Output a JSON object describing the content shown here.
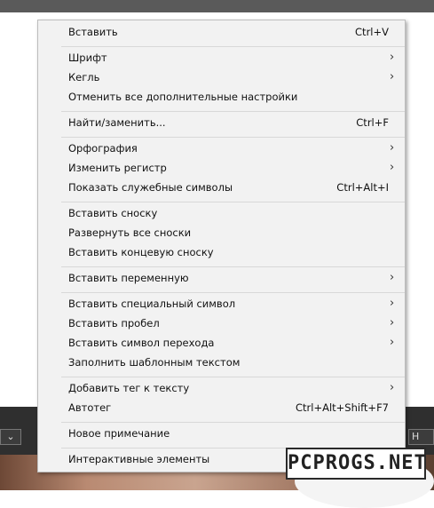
{
  "menu": {
    "items": [
      {
        "label": "Вставить",
        "shortcut": "Ctrl+V",
        "submenu": false
      },
      {
        "label": "Шрифт",
        "shortcut": "",
        "submenu": true
      },
      {
        "label": "Кегль",
        "shortcut": "",
        "submenu": true
      },
      {
        "label": "Отменить все дополнительные настройки",
        "shortcut": "",
        "submenu": false
      },
      {
        "label": "Найти/заменить...",
        "shortcut": "Ctrl+F",
        "submenu": false
      },
      {
        "label": "Орфография",
        "shortcut": "",
        "submenu": true
      },
      {
        "label": "Изменить регистр",
        "shortcut": "",
        "submenu": true
      },
      {
        "label": "Показать служебные символы",
        "shortcut": "Ctrl+Alt+I",
        "submenu": false
      },
      {
        "label": "Вставить сноску",
        "shortcut": "",
        "submenu": false
      },
      {
        "label": "Развернуть все сноски",
        "shortcut": "",
        "submenu": false
      },
      {
        "label": "Вставить концевую сноску",
        "shortcut": "",
        "submenu": false
      },
      {
        "label": "Вставить переменную",
        "shortcut": "",
        "submenu": true
      },
      {
        "label": "Вставить специальный символ",
        "shortcut": "",
        "submenu": true
      },
      {
        "label": "Вставить пробел",
        "shortcut": "",
        "submenu": true
      },
      {
        "label": "Вставить символ перехода",
        "shortcut": "",
        "submenu": true
      },
      {
        "label": "Заполнить шаблонным текстом",
        "shortcut": "",
        "submenu": false
      },
      {
        "label": "Добавить тег к тексту",
        "shortcut": "",
        "submenu": true
      },
      {
        "label": "Автотег",
        "shortcut": "Ctrl+Alt+Shift+F7",
        "submenu": false
      },
      {
        "label": "Новое примечание",
        "shortcut": "",
        "submenu": false
      },
      {
        "label": "Интерактивные элементы",
        "shortcut": "",
        "submenu": false
      }
    ],
    "submenu_glyph": "›"
  },
  "toolbar": {
    "dropdown_glyph": "⌄",
    "right_box_text": "Н"
  },
  "watermark": {
    "text": "PCPROGS.NET"
  },
  "colors": {
    "menu_bg": "#f2f2f2",
    "menu_border": "#bdbdbd",
    "separator": "#d8d8d8",
    "toolbar_bg": "#2f2f2f"
  }
}
